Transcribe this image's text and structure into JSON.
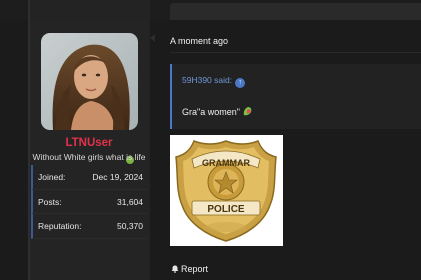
{
  "author": {
    "username": "LTNUser",
    "user_title": "Without White girls what is life",
    "online": true,
    "stats": [
      {
        "label": "Joined:",
        "value": "Dec 19, 2024"
      },
      {
        "label": "Posts:",
        "value": "31,604"
      },
      {
        "label": "Reputation:",
        "value": "50,370"
      }
    ]
  },
  "post": {
    "timestamp": "A moment ago",
    "quote": {
      "author_line": "59H390 said:",
      "text": "Gra\"a women\""
    },
    "badge_image": {
      "top_text": "GRAMMAR",
      "bottom_text": "POLICE"
    },
    "actions": {
      "report_label": "Report"
    }
  },
  "colors": {
    "username": "#e0324b",
    "quote_accent": "#4a78c5",
    "online": "#7cb342",
    "stat_accent": "#3b5998"
  },
  "icons": [
    "up-arrow-icon",
    "emoji-icon",
    "bell-icon",
    "online-status-icon"
  ]
}
